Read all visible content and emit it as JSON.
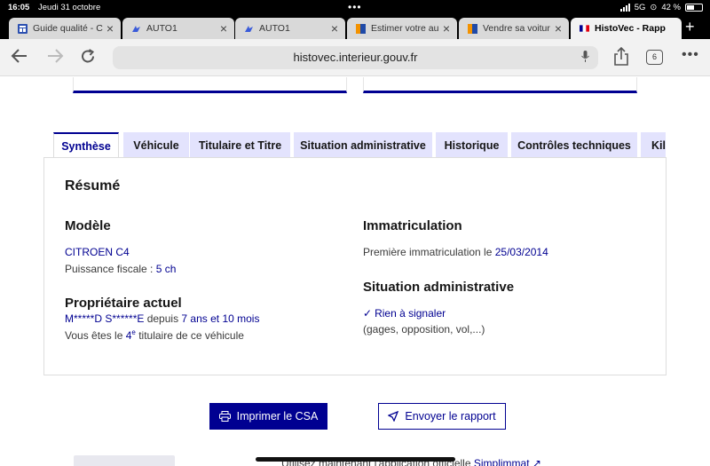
{
  "status_bar": {
    "time": "16:05",
    "date": "Jeudi 31 octobre",
    "network": "5G",
    "battery": "42 %",
    "battery_level": 0.42
  },
  "browser_tabs": [
    {
      "title": "Guide qualité - C",
      "favicon": "grid-icon",
      "active": false
    },
    {
      "title": "AUTO1",
      "favicon": "auto1-icon",
      "active": false
    },
    {
      "title": "AUTO1",
      "favicon": "auto1-icon",
      "active": false
    },
    {
      "title": "Estimer votre au",
      "favicon": "orange-flag-icon",
      "active": false
    },
    {
      "title": "Vendre sa voitur",
      "favicon": "orange-flag-icon",
      "active": false
    },
    {
      "title": "HistoVec - Rapp",
      "favicon": "french-flag-icon",
      "active": true
    }
  ],
  "address_bar": {
    "url": "histovec.interieur.gouv.fr",
    "tab_count": "6"
  },
  "report_tabs": [
    {
      "label": "Synthèse",
      "active": true
    },
    {
      "label": "Véhicule",
      "active": false
    },
    {
      "label": "Titulaire et Titre",
      "active": false
    },
    {
      "label": "Situation administrative",
      "active": false
    },
    {
      "label": "Historique",
      "active": false
    },
    {
      "label": "Contrôles techniques",
      "active": false
    },
    {
      "label": "Kil",
      "active": false
    }
  ],
  "summary": {
    "title": "Résumé",
    "model": {
      "heading": "Modèle",
      "name": "CITROEN C4",
      "power_label": "Puissance fiscale : ",
      "power_value": "5 ch"
    },
    "owner": {
      "heading": "Propriétaire actuel",
      "name": "M*****D S******E",
      "since_label": " depuis ",
      "since_value": "7 ans et 10 mois",
      "rank_prefix": "Vous êtes le ",
      "rank_number": "4",
      "rank_suffix": "e",
      "rank_tail": " titulaire de ce véhicule"
    },
    "registration": {
      "heading": "Immatriculation",
      "first_label": "Première immatriculation le ",
      "first_date": "25/03/2014"
    },
    "admin": {
      "heading": "Situation administrative",
      "status": "Rien à signaler",
      "details": "(gages, opposition, vol,...)"
    }
  },
  "actions": {
    "print_label": "Imprimer le CSA",
    "send_label": "Envoyer le rapport"
  },
  "footer": {
    "text": "Utilisez maintenant l'application officielle ",
    "link": "Simplimmat"
  },
  "colors": {
    "accent": "#000091",
    "tab_bg": "#e3e3fd",
    "text": "#161616"
  }
}
